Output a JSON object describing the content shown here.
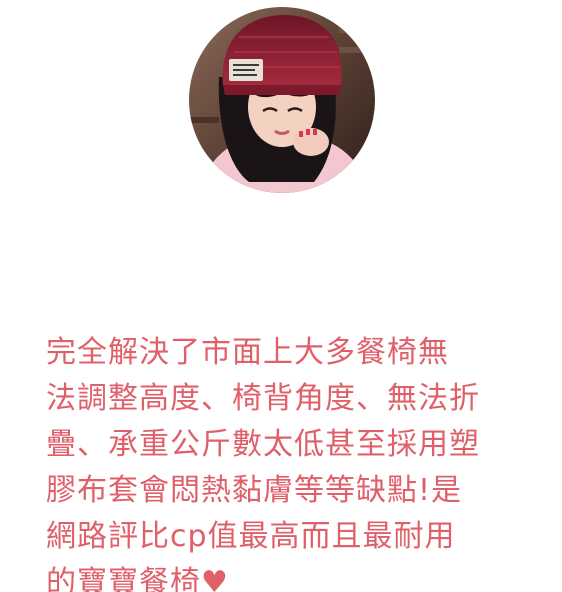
{
  "profile": {
    "avatar_label": "",
    "quote_text": "完全解決了市面上大多餐椅無\n法調整高度、椅背角度、無法折\n疊、承重公斤數太低甚至採用塑\n膠布套會悶熱黏膚等等缺點!是\n網路評比cp值最高而且最耐用\n的寶寶餐椅♥"
  },
  "colors": {
    "text": "#e0606a",
    "background": "#ffffff",
    "hat": "#8a1f32",
    "hair": "#1a1416",
    "skin": "#f3d2c2",
    "sweater": "#f2c7cf",
    "backdrop": "#5b4034"
  }
}
